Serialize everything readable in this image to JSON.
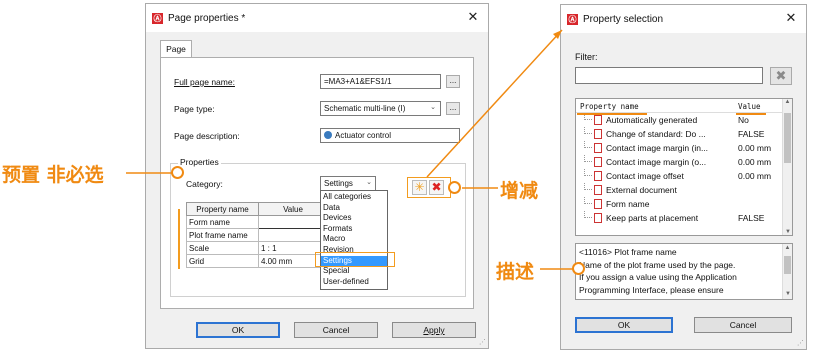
{
  "left_dialog": {
    "title": "Page properties *",
    "tab": "Page",
    "full_page_name_label": "Full page name:",
    "full_page_name_value": "=MA3+A1&EFS1/1",
    "page_type_label": "Page type:",
    "page_type_value": "Schematic multi-line (I)",
    "page_description_label": "Page description:",
    "page_description_value": "Actuator control",
    "properties_group": "Properties",
    "category_label": "Category:",
    "category_value": "Settings",
    "category_options": [
      "All categories",
      "Data",
      "Devices",
      "Formats",
      "Macro",
      "Revision",
      "Settings",
      "Special",
      "User-defined"
    ],
    "table_headers": [
      "Property name",
      "Value"
    ],
    "table_rows": [
      {
        "name": "Form name",
        "value": ""
      },
      {
        "name": "Plot frame name",
        "value": ""
      },
      {
        "name": "Scale",
        "value": "1 : 1"
      },
      {
        "name": "Grid",
        "value": "4.00 mm"
      }
    ],
    "buttons": {
      "ok": "OK",
      "cancel": "Cancel",
      "apply": "Apply"
    },
    "dots": "..."
  },
  "right_dialog": {
    "title": "Property selection",
    "filter_label": "Filter:",
    "filter_value": "",
    "col_name": "Property name",
    "col_value": "Value",
    "rows": [
      {
        "name": "Automatically generated",
        "value": "No"
      },
      {
        "name": "Change of standard: Do ...",
        "value": "FALSE"
      },
      {
        "name": "Contact image margin (in...",
        "value": "0.00 mm"
      },
      {
        "name": "Contact image margin (o...",
        "value": "0.00 mm"
      },
      {
        "name": "Contact image offset",
        "value": "0.00 mm"
      },
      {
        "name": "External document",
        "value": ""
      },
      {
        "name": "Form name",
        "value": ""
      },
      {
        "name": "Keep parts at placement",
        "value": "FALSE"
      }
    ],
    "desc_line1": "<11016> Plot frame name",
    "desc_line2": "Name of the plot frame used by the page.",
    "desc_line3": "If you assign a value using the Application",
    "desc_line4": "Programming Interface, please ensure",
    "buttons": {
      "ok": "OK",
      "cancel": "Cancel"
    }
  },
  "annotations": {
    "preset": "预置 非必选",
    "add_remove": "增减",
    "description": "描述"
  },
  "colors": {
    "accent": "#f08a12",
    "app_icon": "#d8262b",
    "selection": "#3399ff",
    "delete": "#d22"
  }
}
